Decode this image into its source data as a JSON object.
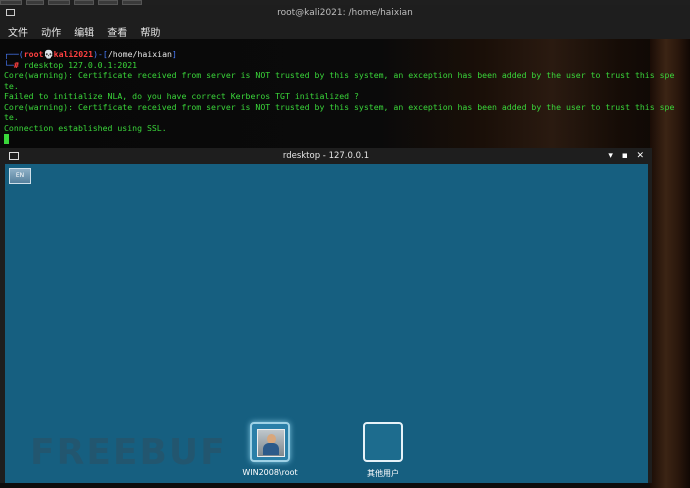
{
  "terminal": {
    "title": "root@kali2021: /home/haixian",
    "menu": [
      "文件",
      "动作",
      "编辑",
      "查看",
      "帮助"
    ],
    "prompt": {
      "user": "root",
      "skull": "💀",
      "host": "kali2021",
      "cwd": "/home/haixian",
      "command": "rdesktop 127.0.0.1:2021"
    },
    "output": [
      "Core(warning): Certificate received from server is NOT trusted by this system, an exception has been added by the user to trust this spe",
      "te.",
      "Failed to initialize NLA, do you have correct Kerberos TGT initialized ?",
      "Core(warning): Certificate received from server is NOT trusted by this system, an exception has been added by the user to trust this spe",
      "te.",
      "Connection established using SSL."
    ]
  },
  "rdesktop": {
    "title": "rdesktop - 127.0.0.1",
    "controls": [
      "▾",
      "▪",
      "✕"
    ],
    "lang_badge": "EN",
    "users": [
      {
        "label": "WIN2008\\root",
        "icon": "user-photo-icon"
      },
      {
        "label": "其他用户",
        "icon": "other-user-icon"
      }
    ]
  },
  "watermark": "FREEBUF",
  "colors": {
    "terminal_text": "#3ad63a",
    "desktop_bg": "#165f80",
    "prompt_path": "#4a7dff",
    "prompt_user": "#ff4040"
  }
}
